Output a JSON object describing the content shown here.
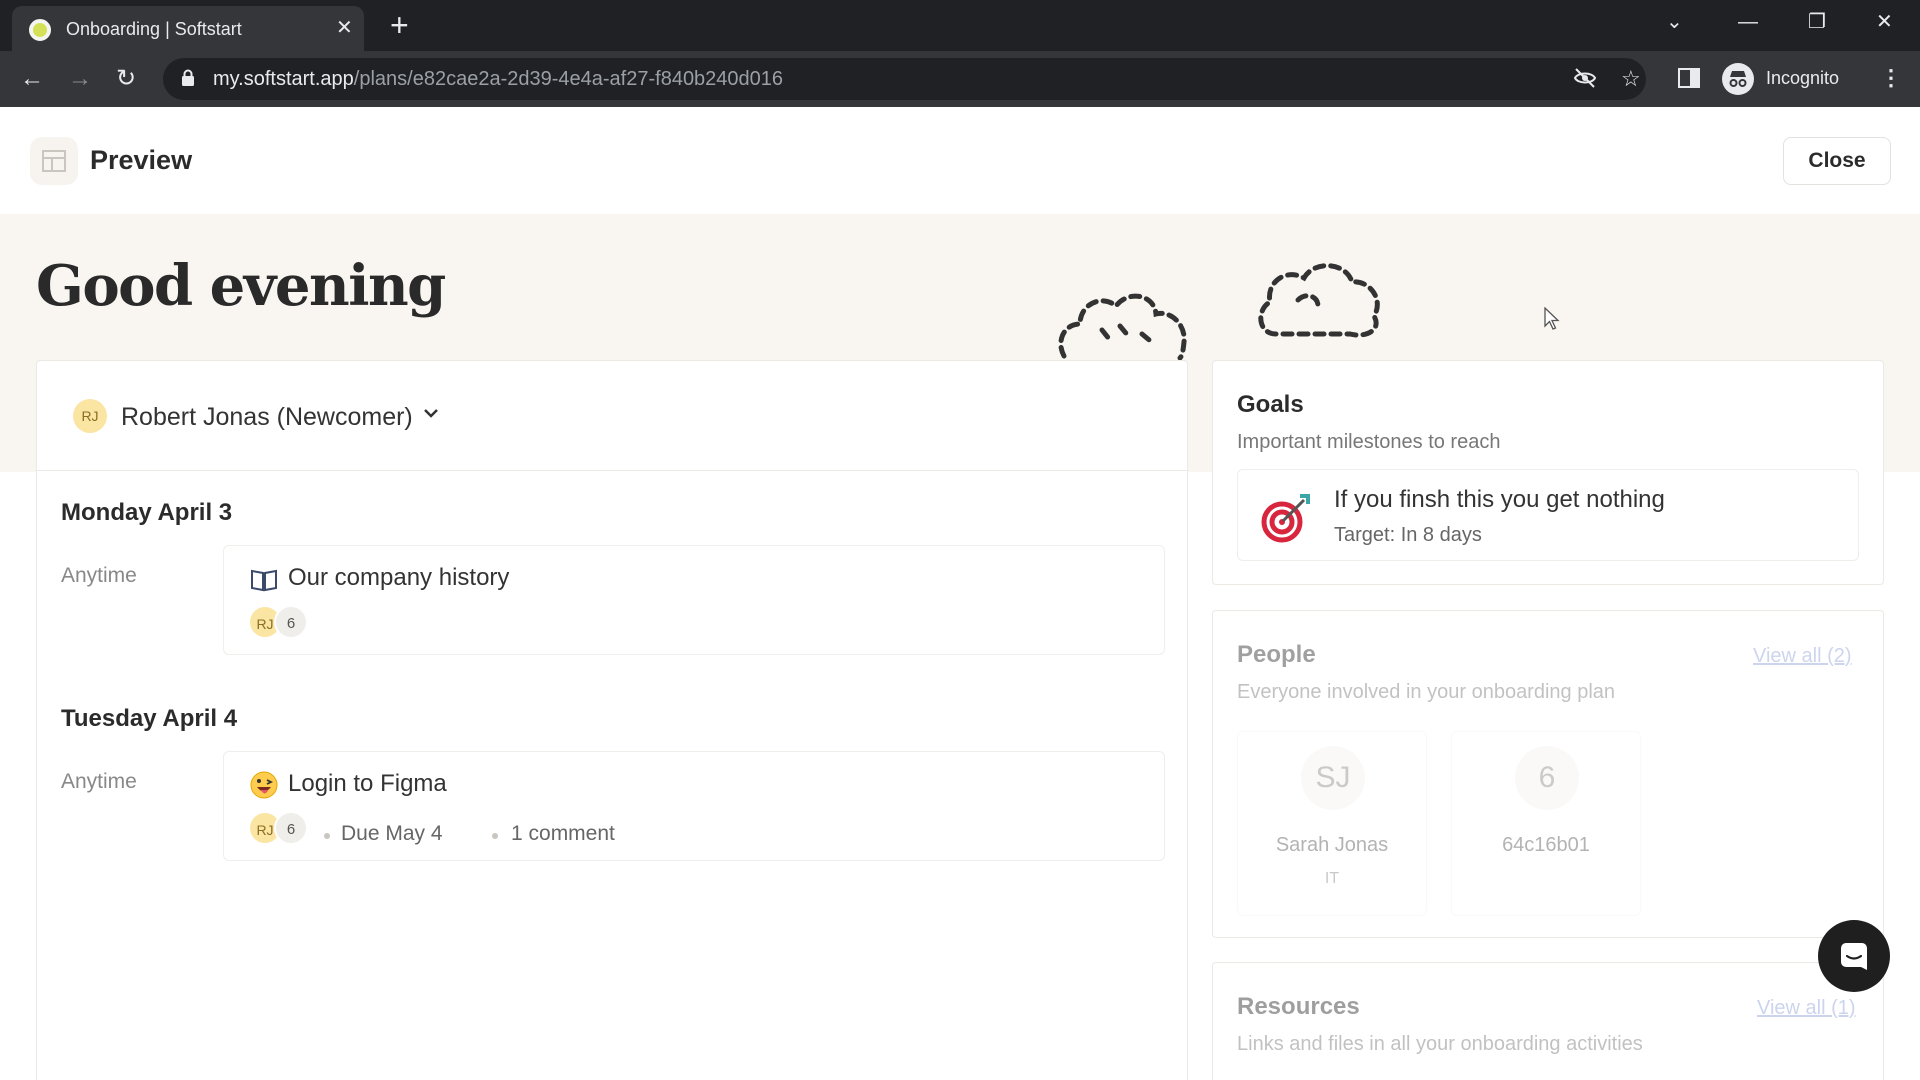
{
  "browser": {
    "tab_title": "Onboarding | Softstart",
    "url_host": "my.softstart.app",
    "url_path": "/plans/e82cae2a-2d39-4e4a-af27-f840b240d016",
    "profile_label": "Incognito"
  },
  "header": {
    "title": "Preview",
    "close_label": "Close"
  },
  "greeting": "Good evening",
  "person_selector": {
    "initials": "RJ",
    "name": "Robert Jonas (Newcomer)"
  },
  "schedule": [
    {
      "day": "Monday April 3",
      "time_label": "Anytime",
      "task": {
        "icon": "book-icon",
        "title": "Our company history",
        "assignee_initials": "RJ",
        "assignee_count": "6"
      }
    },
    {
      "day": "Tuesday April 4",
      "time_label": "Anytime",
      "task": {
        "icon": "grinning-face-icon",
        "title": "Login to Figma",
        "assignee_initials": "RJ",
        "assignee_count": "6",
        "due": "Due May 4",
        "comments": "1 comment"
      }
    }
  ],
  "goals": {
    "title": "Goals",
    "subtitle": "Important milestones to reach",
    "items": [
      {
        "icon": "bullseye-icon",
        "text": "If you finsh this you get nothing",
        "target": "Target: In 8 days"
      }
    ]
  },
  "people": {
    "title": "People",
    "subtitle": "Everyone involved in your onboarding plan",
    "view_all": "View all (2)",
    "items": [
      {
        "initials": "SJ",
        "name": "Sarah Jonas",
        "role": "IT"
      },
      {
        "initials": "6",
        "name": "64c16b01",
        "role": ""
      }
    ]
  },
  "resources": {
    "title": "Resources",
    "subtitle": "Links and files in all your onboarding activities",
    "view_all": "View all (1)"
  },
  "colors": {
    "page_bg": "#f9f6f2",
    "avatar_bg": "#fbe5a3",
    "link": "#8f9fd8"
  }
}
